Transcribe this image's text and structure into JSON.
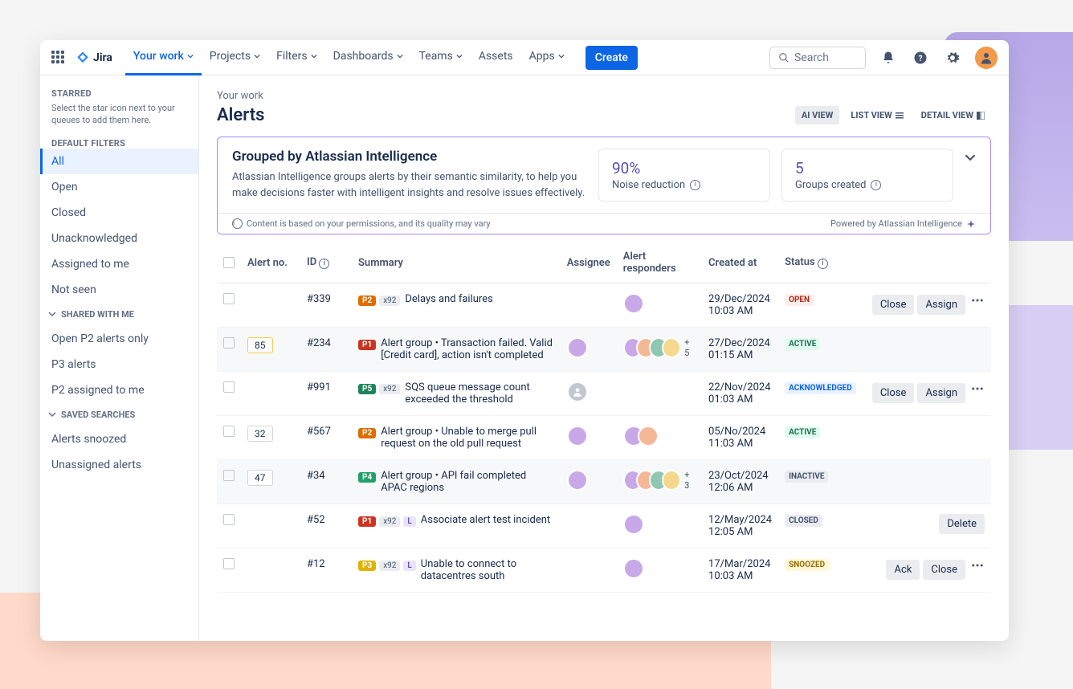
{
  "app": {
    "name": "Jira"
  },
  "nav": {
    "items": [
      "Your work",
      "Projects",
      "Filters",
      "Dashboards",
      "Teams",
      "Assets",
      "Apps"
    ],
    "create": "Create"
  },
  "search": {
    "placeholder": "Search"
  },
  "sidebar": {
    "starred_head": "STARRED",
    "starred_hint": "Select the star icon next to your queues to add them here.",
    "default_head": "DEFAULT FILTERS",
    "default_items": [
      "All",
      "Open",
      "Closed",
      "Unacknowledged",
      "Assigned to me",
      "Not seen"
    ],
    "shared_head": "SHARED WITH ME",
    "shared_items": [
      "Open P2 alerts only",
      "P3 alerts",
      "P2 assigned to me"
    ],
    "saved_head": "SAVED SEARCHES",
    "saved_items": [
      "Alerts snoozed",
      "Unassigned alerts"
    ]
  },
  "page": {
    "crumb": "Your work",
    "title": "Alerts"
  },
  "views": {
    "ai": "AI VIEW",
    "list": "LIST VIEW",
    "detail": "DETAIL VIEW"
  },
  "panel": {
    "title": "Grouped by Atlassian Intelligence",
    "desc": "Atlassian Intelligence groups alerts by their semantic similarity, to help you make decisions faster with intelligent insights and resolve issues effectively.",
    "m1_value": "90%",
    "m1_label": "Noise reduction",
    "m2_value": "5",
    "m2_label": "Groups created",
    "foot_left": "Content is based on your permissions, and its quality may vary",
    "foot_right": "Powered by Atlassian Intelligence"
  },
  "cols": {
    "c1": "Alert no.",
    "c2": "ID",
    "c3": "Summary",
    "c4": "Assignee",
    "c5": "Alert responders",
    "c6": "Created at",
    "c7": "Status"
  },
  "actions": {
    "close": "Close",
    "assign": "Assign",
    "delete": "Delete",
    "ack": "Ack"
  },
  "x92": "x92",
  "L": "L",
  "rows": [
    {
      "count": "",
      "count_style": "",
      "id": "#339",
      "pri": "P2",
      "x92": true,
      "l": false,
      "summary": "Delays and failures",
      "assignee": false,
      "responders": 1,
      "more": "",
      "date": "29/Dec/2024 10:03 AM",
      "status": "OPEN",
      "status_cls": "open",
      "acts": [
        "close",
        "assign"
      ],
      "dots": true
    },
    {
      "count": "85",
      "count_style": "hl",
      "id": "#234",
      "pri": "P1",
      "x92": false,
      "l": false,
      "summary": "Alert group • Transaction failed. Valid [Credit card], action isn't completed",
      "assignee": true,
      "responders": 4,
      "more": "+ 5",
      "date": "27/Dec/2024 01:15 AM",
      "status": "ACTIVE",
      "status_cls": "active",
      "acts": [],
      "dots": false,
      "row_hl": true
    },
    {
      "count": "",
      "count_style": "",
      "id": "#991",
      "pri": "P5",
      "x92": true,
      "l": false,
      "summary": "SQS queue message count exceeded the threshold",
      "assignee": "default",
      "responders": 0,
      "more": "",
      "date": "22/Nov/2024 01:03 AM",
      "status": "ACKNOWLEDGED",
      "status_cls": "ack",
      "acts": [
        "close",
        "assign"
      ],
      "dots": true
    },
    {
      "count": "32",
      "count_style": "plain",
      "id": "#567",
      "pri": "P2",
      "x92": false,
      "l": false,
      "summary": "Alert group • Unable to merge pull request on the old pull request",
      "assignee": true,
      "responders": 2,
      "more": "",
      "date": "05/No/2024 11:03 AM",
      "status": "ACTIVE",
      "status_cls": "active",
      "acts": [],
      "dots": false
    },
    {
      "count": "47",
      "count_style": "plain",
      "id": "#34",
      "pri": "P4",
      "x92": false,
      "l": false,
      "summary": "Alert group • API fail completed APAC regions",
      "assignee": true,
      "responders": 4,
      "more": "+ 3",
      "date": "23/Oct/2024 12:06 AM",
      "status": "INACTIVE",
      "status_cls": "inactive",
      "acts": [],
      "dots": false,
      "row_hl": true
    },
    {
      "count": "",
      "count_style": "",
      "id": "#52",
      "pri": "P1",
      "x92": true,
      "l": true,
      "summary": "Associate alert test incident",
      "assignee": false,
      "responders": 1,
      "more": "",
      "date": "12/May/2024 12:05 AM",
      "status": "CLOSED",
      "status_cls": "closed",
      "acts": [
        "delete"
      ],
      "dots": false
    },
    {
      "count": "",
      "count_style": "",
      "id": "#12",
      "pri": "P3",
      "x92": true,
      "l": true,
      "summary": "Unable to connect to datacentres south",
      "assignee": false,
      "responders": 1,
      "more": "",
      "date": "17/Mar/2024 10:03 AM",
      "status": "SNOOZED",
      "status_cls": "snoozed",
      "acts": [
        "ack",
        "close"
      ],
      "dots": true
    }
  ]
}
